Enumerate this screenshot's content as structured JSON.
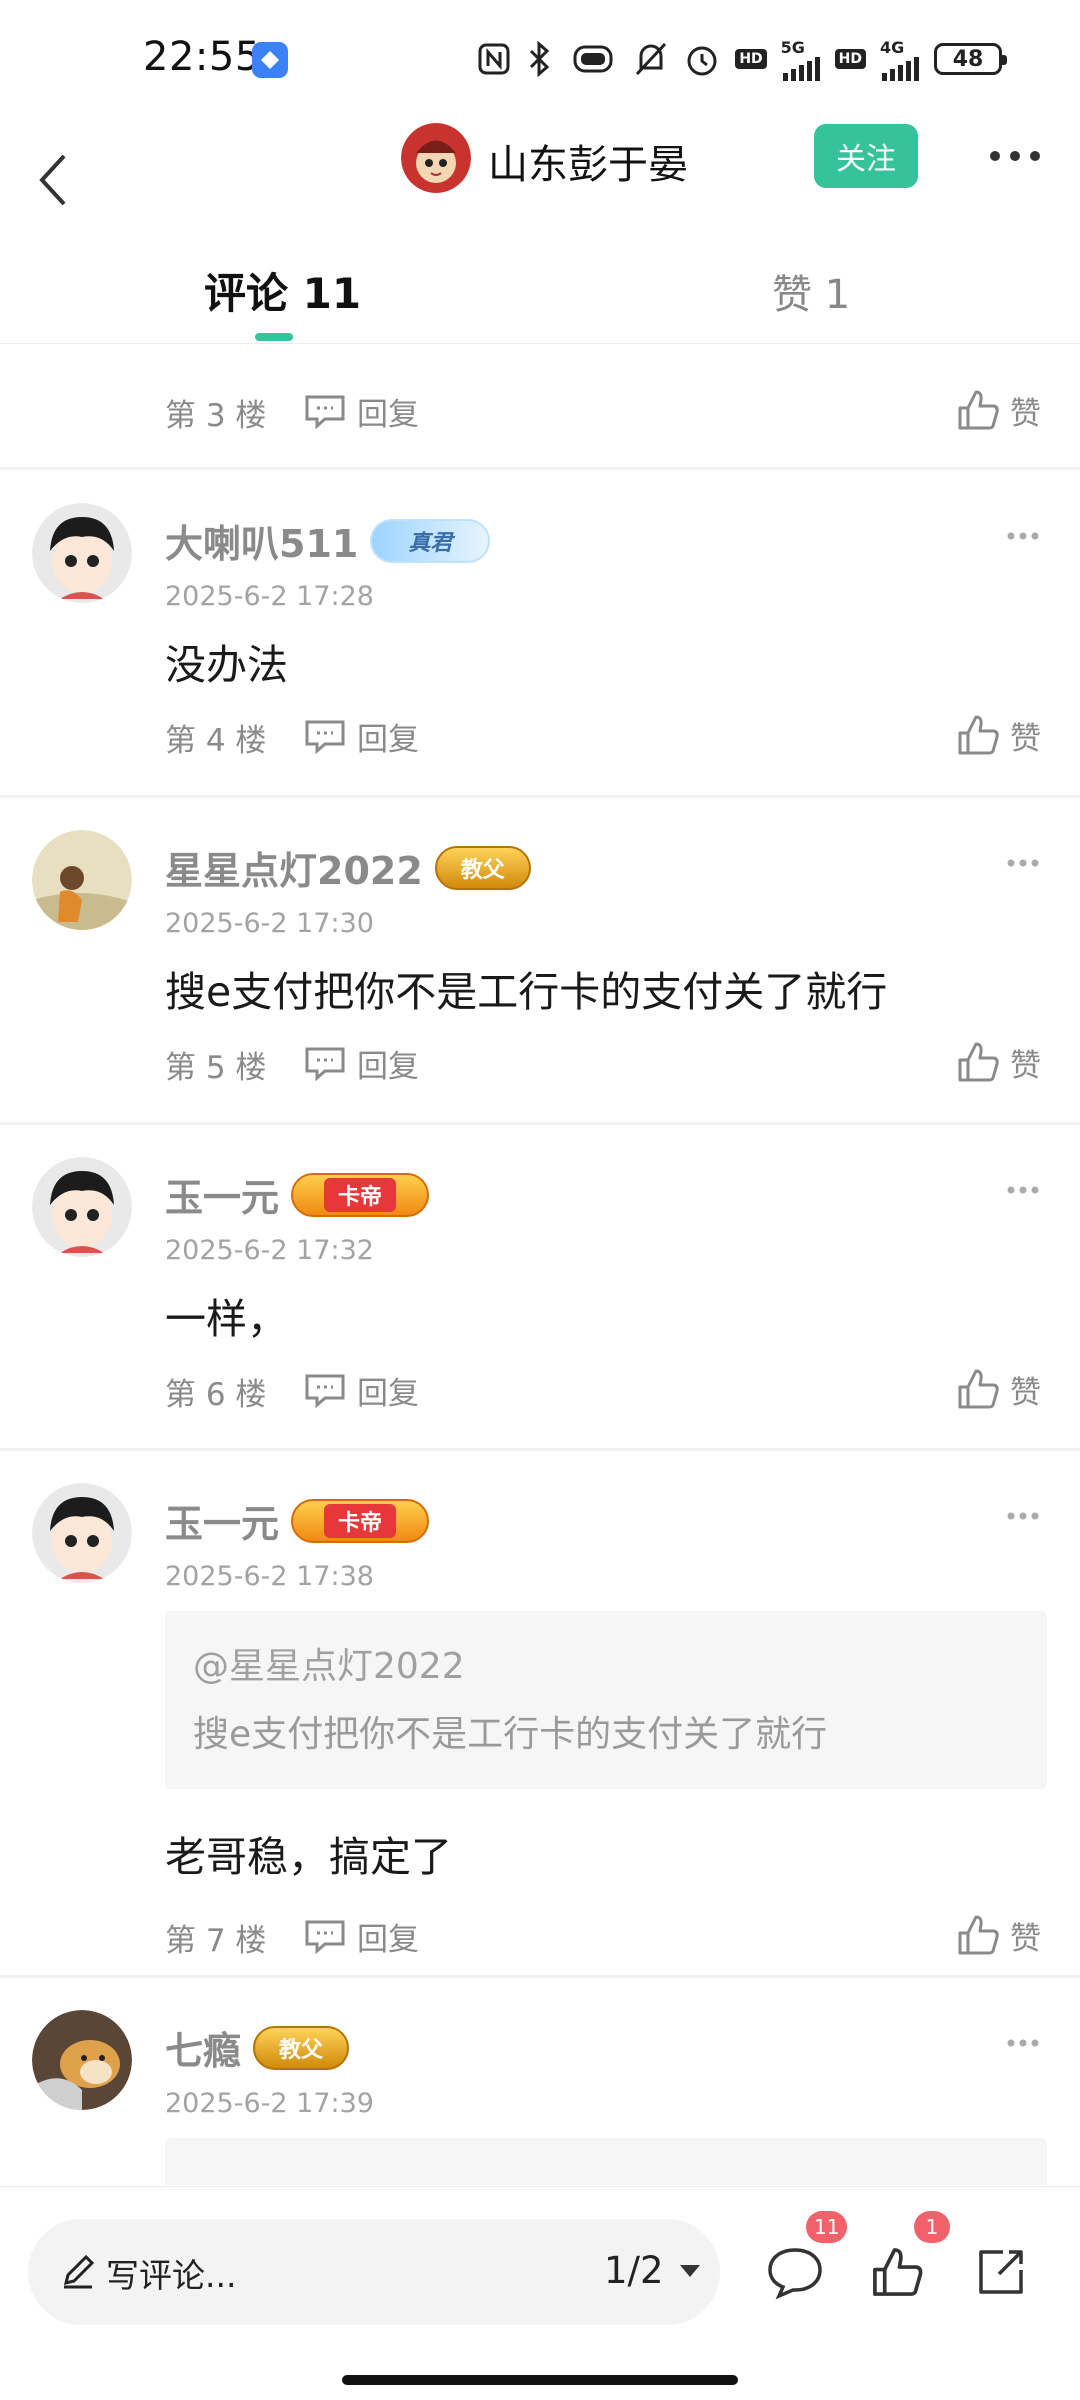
{
  "status_bar": {
    "time": "22:55",
    "network_5g": "5G",
    "network_4g": "4G",
    "hd": "HD",
    "battery": "48"
  },
  "header": {
    "username": "山东彭于晏",
    "follow_label": "关注"
  },
  "tabs": {
    "comments_label": "评论 11",
    "likes_label": "赞 1"
  },
  "comments": [
    {
      "floor": "第 3 楼",
      "reply_label": "回复",
      "like_label": "赞"
    },
    {
      "username": "大喇叭511",
      "badge": "真君",
      "time": "2025-6-2 17:28",
      "text": "没办法",
      "floor": "第 4 楼",
      "reply_label": "回复",
      "like_label": "赞"
    },
    {
      "username": "星星点灯2022",
      "badge": "教父",
      "time": "2025-6-2 17:30",
      "text": "搜e支付把你不是工行卡的支付关了就行",
      "floor": "第 5 楼",
      "reply_label": "回复",
      "like_label": "赞"
    },
    {
      "username": "玉一元",
      "badge": "卡帝",
      "time": "2025-6-2 17:32",
      "text": "一样，",
      "floor": "第 6 楼",
      "reply_label": "回复",
      "like_label": "赞"
    },
    {
      "username": "玉一元",
      "badge": "卡帝",
      "time": "2025-6-2 17:38",
      "quote_user": "@星星点灯2022",
      "quote_text": "搜e支付把你不是工行卡的支付关了就行",
      "text": "老哥稳，搞定了",
      "floor": "第 7 楼",
      "reply_label": "回复",
      "like_label": "赞"
    },
    {
      "username": "七瘾",
      "badge": "教父",
      "time": "2025-6-2 17:39"
    }
  ],
  "bottom_bar": {
    "input_placeholder": "写评论...",
    "pager": "1/2",
    "comment_count": "11",
    "like_count": "1"
  },
  "colors": {
    "accent": "#36c29a",
    "badge_red": "#f0616a",
    "muted_text": "#8a8a8a"
  },
  "icons": [
    "back-arrow-icon",
    "more-icon",
    "reply-icon",
    "thumbs-up-icon",
    "pen-icon",
    "dropdown-icon",
    "comment-bubble-icon",
    "share-icon"
  ]
}
